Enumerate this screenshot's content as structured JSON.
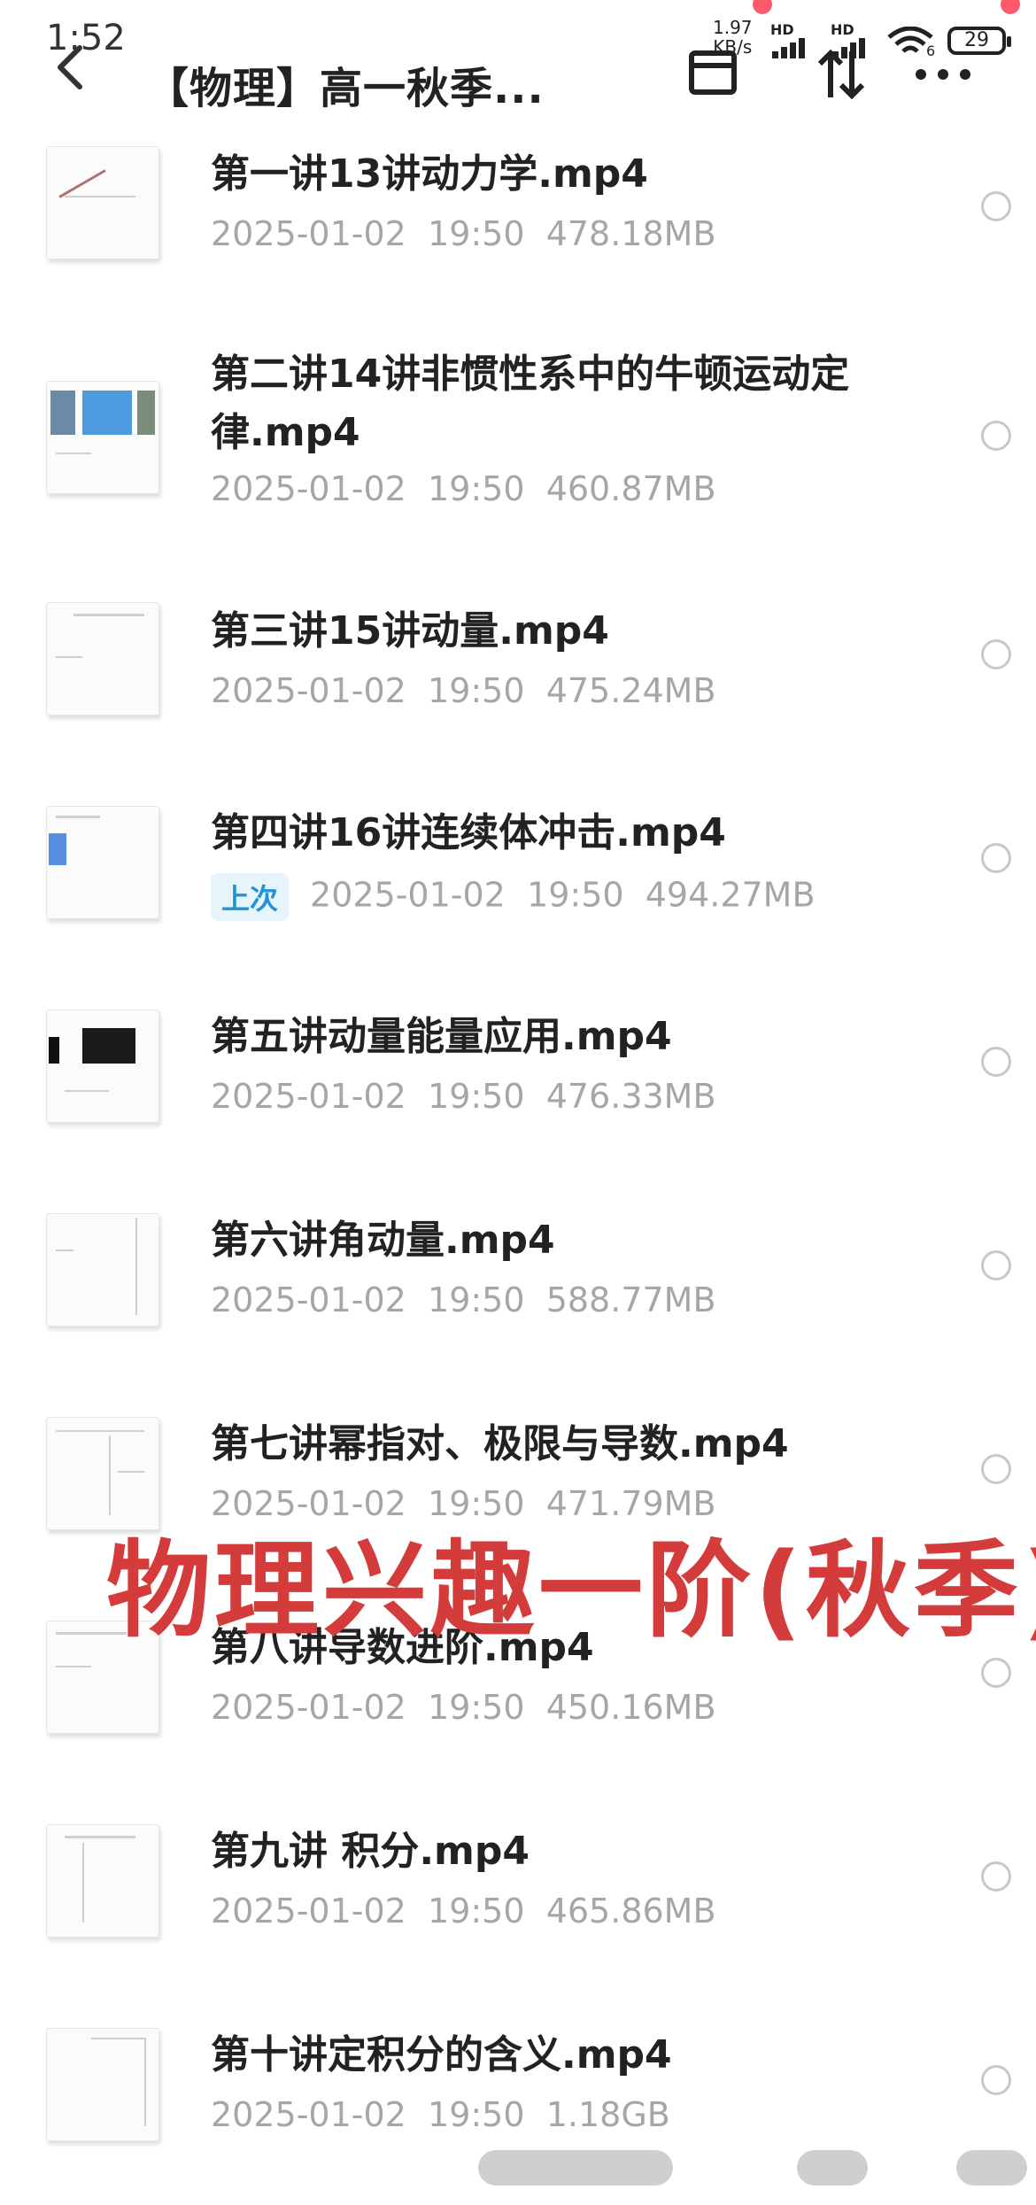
{
  "status_bar": {
    "time": "1:52",
    "net_speed_value": "1.97",
    "net_speed_unit": "KB/s",
    "hd_label_1": "HD",
    "hd_label_2": "HD",
    "wifi_sub": "6",
    "battery": "29"
  },
  "header": {
    "title": "【物理】高一秋季..."
  },
  "files": [
    {
      "title": "第一讲13讲动力学.mp4",
      "date": "2025-01-02",
      "time": "19:50",
      "size": "478.18MB",
      "badge": ""
    },
    {
      "title": "第二讲14讲非惯性系中的牛顿运动定律.mp4",
      "date": "2025-01-02",
      "time": "19:50",
      "size": "460.87MB",
      "badge": ""
    },
    {
      "title": "第三讲15讲动量.mp4",
      "date": "2025-01-02",
      "time": "19:50",
      "size": "475.24MB",
      "badge": ""
    },
    {
      "title": "第四讲16讲连续体冲击.mp4",
      "date": "2025-01-02",
      "time": "19:50",
      "size": "494.27MB",
      "badge": "上次"
    },
    {
      "title": "第五讲动量能量应用.mp4",
      "date": "2025-01-02",
      "time": "19:50",
      "size": "476.33MB",
      "badge": ""
    },
    {
      "title": "第六讲角动量.mp4",
      "date": "2025-01-02",
      "time": "19:50",
      "size": "588.77MB",
      "badge": ""
    },
    {
      "title": "第七讲幂指对、极限与导数.mp4",
      "date": "2025-01-02",
      "time": "19:50",
      "size": "471.79MB",
      "badge": ""
    },
    {
      "title": "第八讲导数进阶.mp4",
      "date": "2025-01-02",
      "time": "19:50",
      "size": "450.16MB",
      "badge": ""
    },
    {
      "title": "第九讲 积分.mp4",
      "date": "2025-01-02",
      "time": "19:50",
      "size": "465.86MB",
      "badge": ""
    },
    {
      "title": "第十讲定积分的含义.mp4",
      "date": "2025-01-02",
      "time": "19:50",
      "size": "1.18GB",
      "badge": ""
    }
  ],
  "watermark": "物理兴趣一阶(秋季)",
  "colors": {
    "accent_blue": "#2294d6",
    "watermark_red": "#d43c3c"
  }
}
